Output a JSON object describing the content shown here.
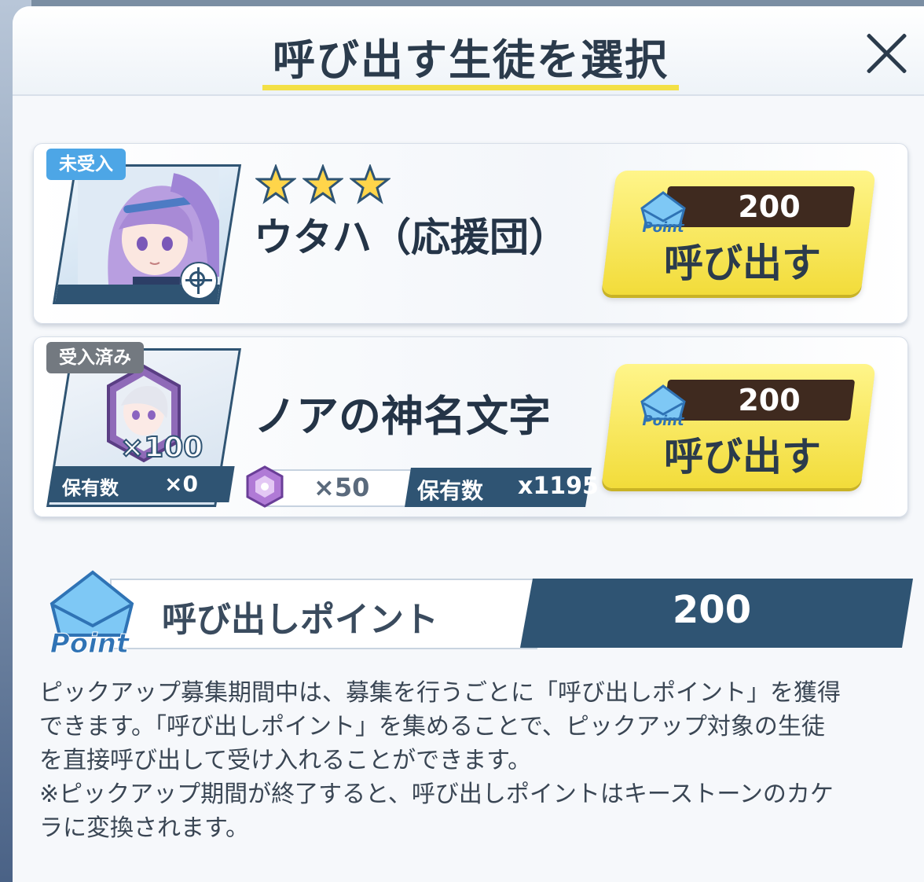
{
  "dialog": {
    "title": "呼び出す生徒を選択"
  },
  "cards": [
    {
      "badge": "未受入",
      "stars": 3,
      "name": "ウタハ（応援団）",
      "cost": "200",
      "button_label": "呼び出す"
    },
    {
      "badge": "受入済み",
      "name": "ノアの神名文字",
      "item_qty": "×100",
      "owned_label": "保有数",
      "owned_value": "×0",
      "material_cost": "×50",
      "material_owned_label": "保有数",
      "material_owned_value": "x1195",
      "cost": "200",
      "button_label": "呼び出す"
    }
  ],
  "points": {
    "icon_text": "Point",
    "label": "呼び出しポイント",
    "value": "200"
  },
  "description": [
    "ピックアップ募集期間中は、募集を行うごとに「呼び出しポイント」を獲得",
    "できます。「呼び出しポイント」を集めることで、ピックアップ対象の生徒",
    "を直接呼び出して受け入れることができます。",
    "※ピックアップ期間が終了すると、呼び出しポイントはキーストーンのカケ",
    "ラに変換されます。"
  ],
  "colors": {
    "accent_yellow": "#f3e046",
    "dark_navy": "#2f5473",
    "badge_blue": "#4da6e6",
    "badge_gray": "#737980"
  }
}
